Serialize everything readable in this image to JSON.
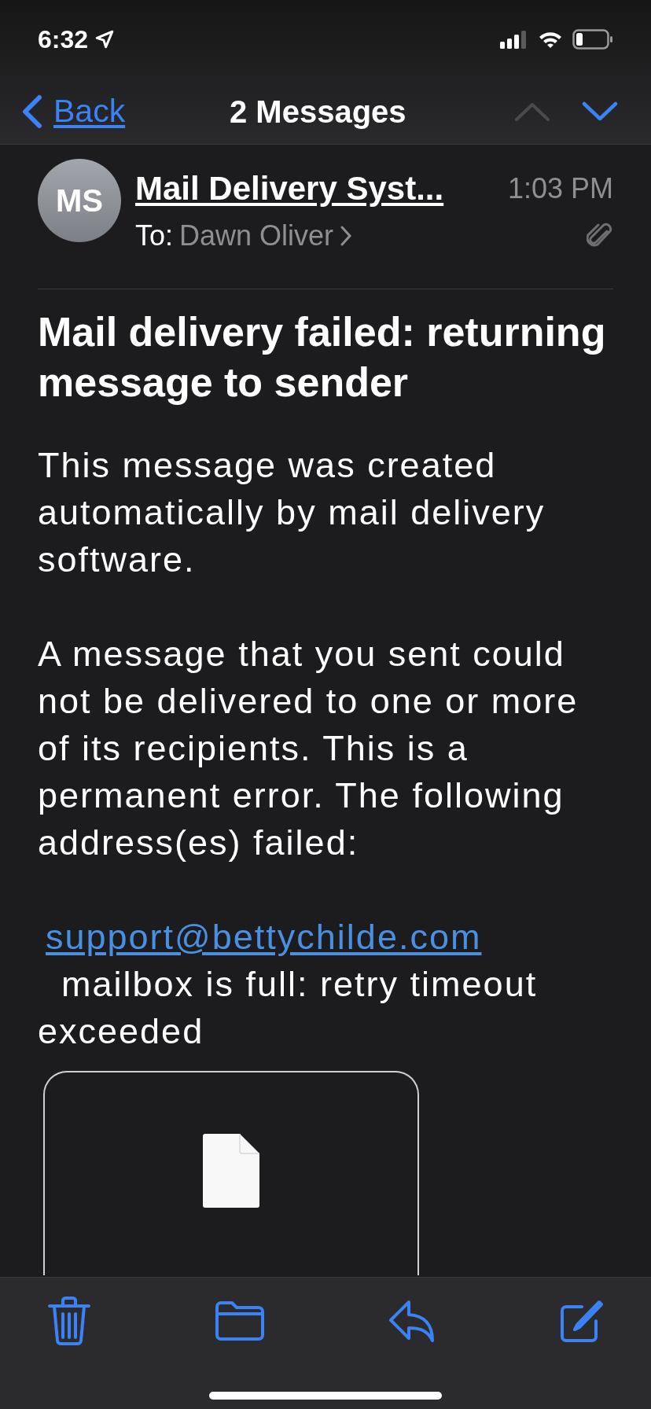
{
  "status_bar": {
    "time": "6:32"
  },
  "nav": {
    "back": "Back",
    "title": "2 Messages",
    "previous_enabled": false,
    "next_enabled": true
  },
  "header": {
    "initials": "MS",
    "sender": "Mail Delivery Syst...",
    "time": "1:03 PM",
    "to_label": "To:",
    "recipient": "Dawn Oliver",
    "has_attachment": true
  },
  "subject": "Mail delivery failed: returning message to sender",
  "body": [
    {
      "kind": "text",
      "text": "This message was created automatically by mail delivery software."
    },
    {
      "kind": "text",
      "text": "A message that you sent could not be delivered to one or more of its recipients. This is a permanent error. The following address(es) failed:"
    },
    {
      "kind": "address",
      "link": "support@bettychilde.com",
      "text": "mailbox is full: retry timeout exceeded"
    }
  ],
  "attachment": {
    "kind": "file"
  },
  "toolbar": [
    {
      "kind": "trash"
    },
    {
      "kind": "folder"
    },
    {
      "kind": "reply"
    },
    {
      "kind": "compose"
    }
  ]
}
